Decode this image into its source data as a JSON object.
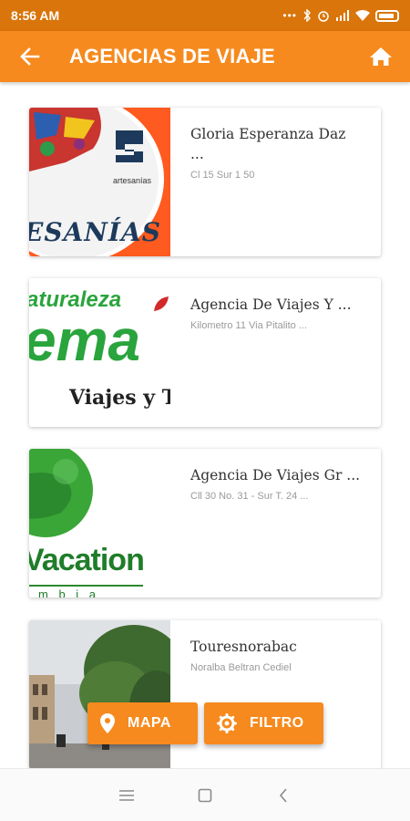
{
  "status_bar": {
    "time": "8:56 AM",
    "dots": "•••"
  },
  "header": {
    "title": "AGENCIAS DE VIAJE",
    "back_icon": "arrow-left-icon",
    "home_icon": "home-icon"
  },
  "agencies": [
    {
      "name": "Gloria Esperanza Daz ...",
      "address": "Cl 15 Sur 1 50",
      "image_text": [
        "artesanías",
        "ESANÍAS"
      ]
    },
    {
      "name": "Agencia De Viajes Y ...",
      "address": "Kilometro 11 Via Pitalito ...",
      "image_text": [
        "aturaleza",
        "ema",
        "Viajes y Tu"
      ]
    },
    {
      "name": "Agencia De Viajes Gr ...",
      "address": "Cll 30 No. 31 - Sur T. 24 ...",
      "image_text": [
        "Vacation",
        "m b i a"
      ]
    },
    {
      "name": "Touresnorabac",
      "address": "Noralba Beltran Cediel"
    }
  ],
  "buttons": {
    "map_label": "MAPA",
    "filter_label": "FILTRO"
  },
  "colors": {
    "primary": "#f68a1e",
    "status_bar": "#d9750a"
  }
}
